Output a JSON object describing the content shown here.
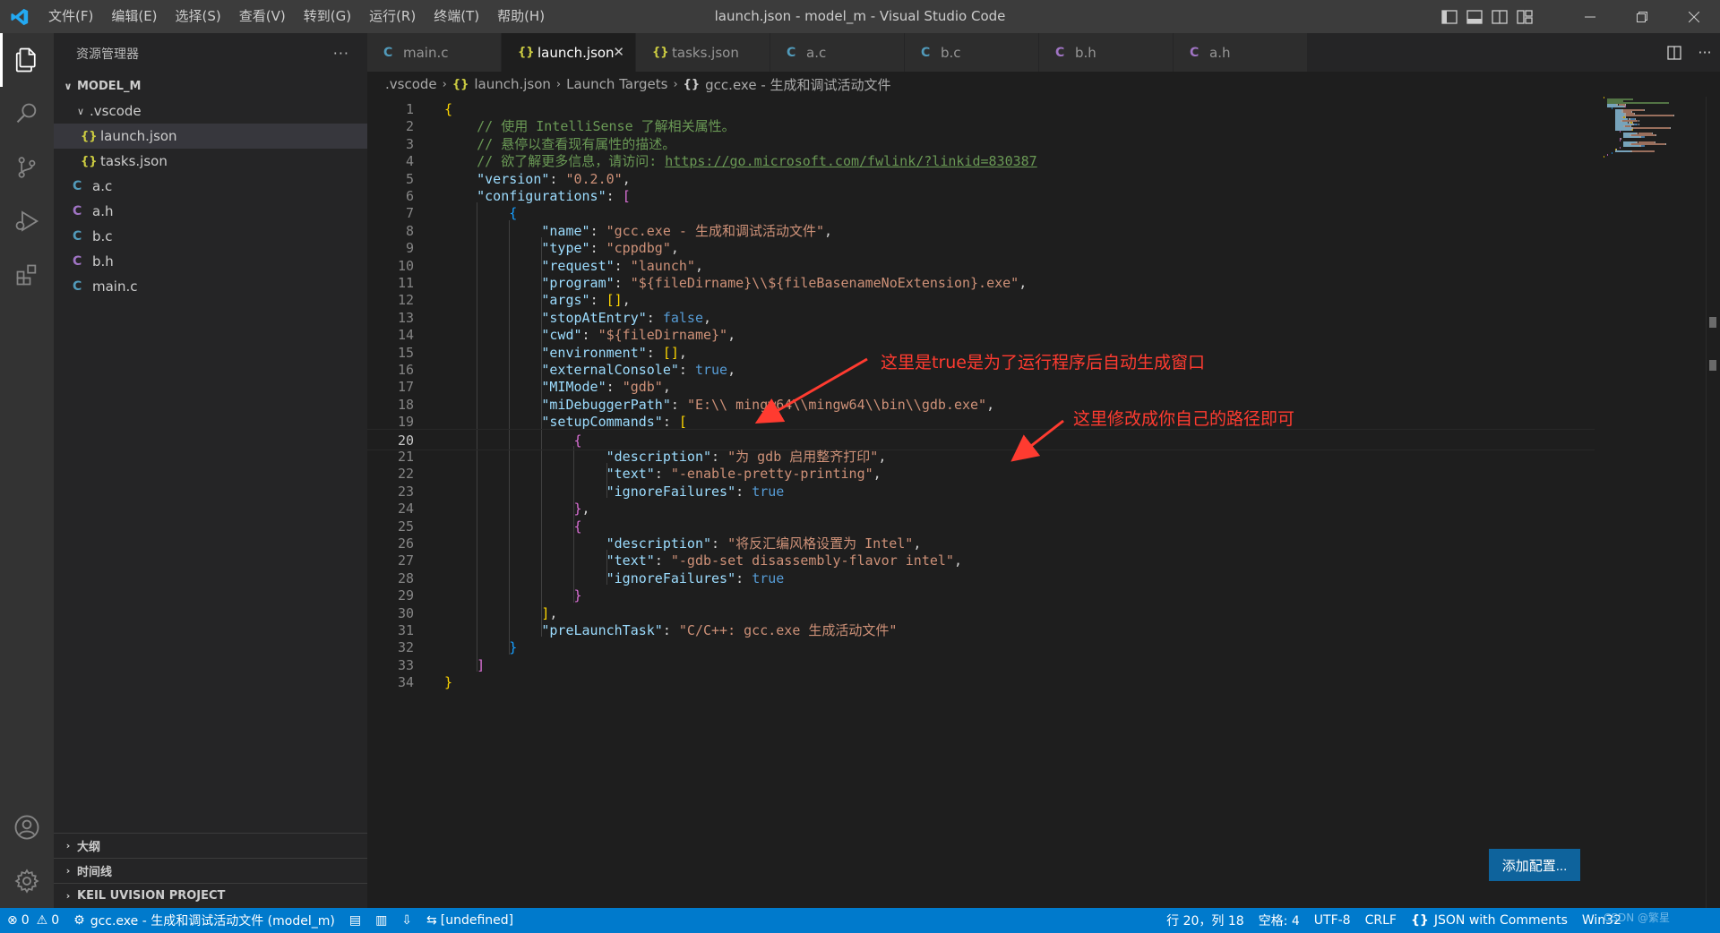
{
  "app": {
    "window_title": "launch.json - model_m - Visual Studio Code",
    "menu": [
      "文件(F)",
      "编辑(E)",
      "选择(S)",
      "查看(V)",
      "转到(G)",
      "运行(R)",
      "终端(T)",
      "帮助(H)"
    ]
  },
  "sidebar": {
    "title": "资源管理器",
    "more": "···",
    "project": "MODEL_M",
    "folder": ".vscode",
    "folder_files": [
      {
        "icon": "{}",
        "label": "launch.json"
      },
      {
        "icon": "{}",
        "label": "tasks.json"
      }
    ],
    "files": [
      {
        "icon": "C",
        "label": "a.c"
      },
      {
        "icon": "C",
        "label": "a.h"
      },
      {
        "icon": "C",
        "label": "b.c"
      },
      {
        "icon": "C",
        "label": "b.h"
      },
      {
        "icon": "C",
        "label": "main.c"
      }
    ],
    "sections": [
      "大纲",
      "时间线",
      "KEIL UVISION PROJECT"
    ]
  },
  "tabs": [
    {
      "icon": "C",
      "label": "main.c"
    },
    {
      "icon": "{}",
      "label": "launch.json",
      "close": "✕"
    },
    {
      "icon": "{}",
      "label": "tasks.json"
    },
    {
      "icon": "C",
      "label": "a.c"
    },
    {
      "icon": "C",
      "label": "b.c"
    },
    {
      "icon": "C",
      "label": "b.h"
    },
    {
      "icon": "C",
      "label": "a.h"
    }
  ],
  "breadcrumb": {
    "folder": ".vscode",
    "file_icon": "{}",
    "file": "launch.json",
    "node1": "Launch Targets",
    "node2_icon": "{}",
    "node2": "gcc.exe - 生成和调试活动文件"
  },
  "editor": {
    "current_line": 20,
    "lines": [
      [
        [
          "{",
          "t-brace1"
        ]
      ],
      [
        [
          "    ",
          ""
        ],
        [
          "// 使用 IntelliSense 了解相关属性。",
          "t-cmt"
        ]
      ],
      [
        [
          "    ",
          ""
        ],
        [
          "// 悬停以查看现有属性的描述。",
          "t-cmt"
        ]
      ],
      [
        [
          "    ",
          ""
        ],
        [
          "// 欲了解更多信息，请访问: ",
          "t-cmt"
        ],
        [
          "https://go.microsoft.com/fwlink/?linkid=830387",
          "t-link"
        ]
      ],
      [
        [
          "    ",
          ""
        ],
        [
          "\"version\"",
          "t-key"
        ],
        [
          ": ",
          "t-punct"
        ],
        [
          "\"0.2.0\"",
          "t-str"
        ],
        [
          ",",
          "t-punct"
        ]
      ],
      [
        [
          "    ",
          ""
        ],
        [
          "\"configurations\"",
          "t-key"
        ],
        [
          ": ",
          "t-punct"
        ],
        [
          "[",
          "t-brace2"
        ]
      ],
      [
        [
          "        ",
          ""
        ],
        [
          "{",
          "t-brace3"
        ]
      ],
      [
        [
          "            ",
          ""
        ],
        [
          "\"name\"",
          "t-key"
        ],
        [
          ": ",
          "t-punct"
        ],
        [
          "\"gcc.exe - 生成和调试活动文件\"",
          "t-str"
        ],
        [
          ",",
          "t-punct"
        ]
      ],
      [
        [
          "            ",
          ""
        ],
        [
          "\"type\"",
          "t-key"
        ],
        [
          ": ",
          "t-punct"
        ],
        [
          "\"cppdbg\"",
          "t-str"
        ],
        [
          ",",
          "t-punct"
        ]
      ],
      [
        [
          "            ",
          ""
        ],
        [
          "\"request\"",
          "t-key"
        ],
        [
          ": ",
          "t-punct"
        ],
        [
          "\"launch\"",
          "t-str"
        ],
        [
          ",",
          "t-punct"
        ]
      ],
      [
        [
          "            ",
          ""
        ],
        [
          "\"program\"",
          "t-key"
        ],
        [
          ": ",
          "t-punct"
        ],
        [
          "\"${fileDirname}\\\\${fileBasenameNoExtension}.exe\"",
          "t-str"
        ],
        [
          ",",
          "t-punct"
        ]
      ],
      [
        [
          "            ",
          ""
        ],
        [
          "\"args\"",
          "t-key"
        ],
        [
          ": ",
          "t-punct"
        ],
        [
          "[]",
          "t-brace1"
        ],
        [
          ",",
          "t-punct"
        ]
      ],
      [
        [
          "            ",
          ""
        ],
        [
          "\"stopAtEntry\"",
          "t-key"
        ],
        [
          ": ",
          "t-punct"
        ],
        [
          "false",
          "t-kw"
        ],
        [
          ",",
          "t-punct"
        ]
      ],
      [
        [
          "            ",
          ""
        ],
        [
          "\"cwd\"",
          "t-key"
        ],
        [
          ": ",
          "t-punct"
        ],
        [
          "\"${fileDirname}\"",
          "t-str"
        ],
        [
          ",",
          "t-punct"
        ]
      ],
      [
        [
          "            ",
          ""
        ],
        [
          "\"environment\"",
          "t-key"
        ],
        [
          ": ",
          "t-punct"
        ],
        [
          "[]",
          "t-brace1"
        ],
        [
          ",",
          "t-punct"
        ]
      ],
      [
        [
          "            ",
          ""
        ],
        [
          "\"externalConsole\"",
          "t-key"
        ],
        [
          ": ",
          "t-punct"
        ],
        [
          "true",
          "t-kw"
        ],
        [
          ",",
          "t-punct"
        ]
      ],
      [
        [
          "            ",
          ""
        ],
        [
          "\"MIMode\"",
          "t-key"
        ],
        [
          ": ",
          "t-punct"
        ],
        [
          "\"gdb\"",
          "t-str"
        ],
        [
          ",",
          "t-punct"
        ]
      ],
      [
        [
          "            ",
          ""
        ],
        [
          "\"miDebuggerPath\"",
          "t-key"
        ],
        [
          ": ",
          "t-punct"
        ],
        [
          "\"E:\\\\ mingw64\\\\mingw64\\\\bin\\\\gdb.exe\"",
          "t-str"
        ],
        [
          ",",
          "t-punct"
        ]
      ],
      [
        [
          "            ",
          ""
        ],
        [
          "\"setupCommands\"",
          "t-key"
        ],
        [
          ": ",
          "t-punct"
        ],
        [
          "[",
          "t-brace1"
        ]
      ],
      [
        [
          "                ",
          ""
        ],
        [
          "{",
          "t-brace2"
        ]
      ],
      [
        [
          "                    ",
          ""
        ],
        [
          "\"description\"",
          "t-key"
        ],
        [
          ": ",
          "t-punct"
        ],
        [
          "\"为 gdb 启用整齐打印\"",
          "t-str"
        ],
        [
          ",",
          "t-punct"
        ]
      ],
      [
        [
          "                    ",
          ""
        ],
        [
          "\"text\"",
          "t-key"
        ],
        [
          ": ",
          "t-punct"
        ],
        [
          "\"-enable-pretty-printing\"",
          "t-str"
        ],
        [
          ",",
          "t-punct"
        ]
      ],
      [
        [
          "                    ",
          ""
        ],
        [
          "\"ignoreFailures\"",
          "t-key"
        ],
        [
          ": ",
          "t-punct"
        ],
        [
          "true",
          "t-kw"
        ]
      ],
      [
        [
          "                ",
          ""
        ],
        [
          "}",
          "t-brace2"
        ],
        [
          ",",
          "t-punct"
        ]
      ],
      [
        [
          "                ",
          ""
        ],
        [
          "{",
          "t-brace2"
        ]
      ],
      [
        [
          "                    ",
          ""
        ],
        [
          "\"description\"",
          "t-key"
        ],
        [
          ": ",
          "t-punct"
        ],
        [
          "\"将反汇编风格设置为 Intel\"",
          "t-str"
        ],
        [
          ",",
          "t-punct"
        ]
      ],
      [
        [
          "                    ",
          ""
        ],
        [
          "\"text\"",
          "t-key"
        ],
        [
          ": ",
          "t-punct"
        ],
        [
          "\"-gdb-set disassembly-flavor intel\"",
          "t-str"
        ],
        [
          ",",
          "t-punct"
        ]
      ],
      [
        [
          "                    ",
          ""
        ],
        [
          "\"ignoreFailures\"",
          "t-key"
        ],
        [
          ": ",
          "t-punct"
        ],
        [
          "true",
          "t-kw"
        ]
      ],
      [
        [
          "                ",
          ""
        ],
        [
          "}",
          "t-brace2"
        ]
      ],
      [
        [
          "            ",
          ""
        ],
        [
          "]",
          "t-brace1"
        ],
        [
          ",",
          "t-punct"
        ]
      ],
      [
        [
          "            ",
          ""
        ],
        [
          "\"preLaunchTask\"",
          "t-key"
        ],
        [
          ": ",
          "t-punct"
        ],
        [
          "\"C/C++: gcc.exe 生成活动文件\"",
          "t-str"
        ]
      ],
      [
        [
          "        ",
          ""
        ],
        [
          "}",
          "t-brace3"
        ]
      ],
      [
        [
          "    ",
          ""
        ],
        [
          "]",
          "t-brace2"
        ]
      ],
      [
        [
          "}",
          "t-brace1"
        ]
      ]
    ]
  },
  "annotations": {
    "note1": "这里是true是为了运行程序后自动生成窗口",
    "note2": "这里修改成你自己的路径即可"
  },
  "add_config_label": "添加配置...",
  "statusbar": {
    "errors": "0",
    "warnings": "0",
    "debug_target": "gcc.exe - 生成和调试活动文件 (model_m)",
    "undefined": "[undefined]",
    "position": "行 20，列 18",
    "spaces": "空格: 4",
    "encoding": "UTF-8",
    "eol": "CRLF",
    "language_icon": "{}",
    "language": "JSON with Comments",
    "platform": "Win32"
  },
  "watermark": "CSDN @繁星",
  "colors": {
    "accent": "#007acc",
    "annotation": "#ff3b30",
    "button": "#0e639c"
  },
  "icons": [
    "vscode-logo",
    "explorer-icon",
    "search-icon",
    "source-control-icon",
    "run-debug-icon",
    "extensions-icon",
    "account-icon",
    "settings-gear-icon",
    "split-editor-icon",
    "more-icon"
  ]
}
